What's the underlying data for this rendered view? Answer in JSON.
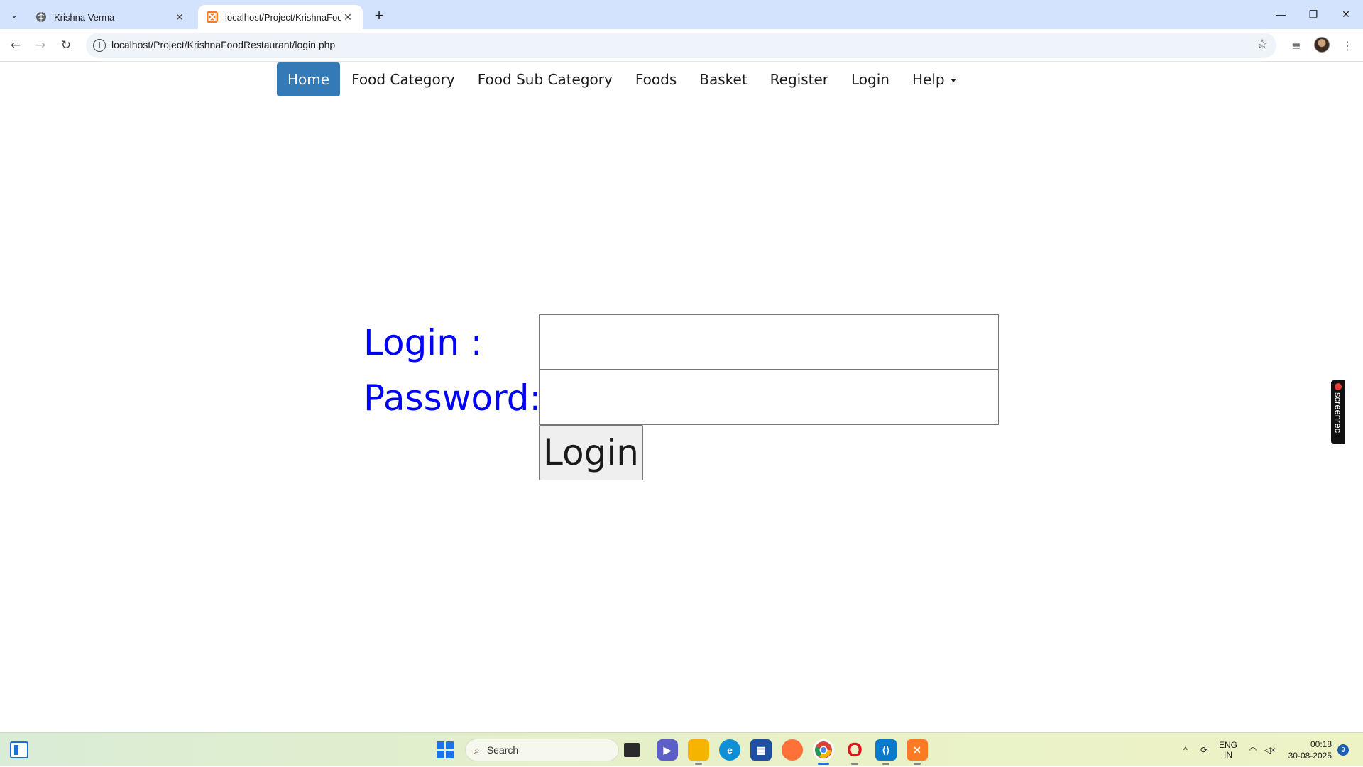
{
  "browser": {
    "tabs": [
      {
        "title": "Krishna Verma",
        "active": false
      },
      {
        "title": "localhost/Project/KrishnaFoodR",
        "active": true
      }
    ],
    "url": "localhost/Project/KrishnaFoodRestaurant/login.php",
    "icons": {
      "tab_search": "chevron-down-icon",
      "back": "back-arrow-icon",
      "forward": "forward-arrow-icon",
      "reload": "reload-icon",
      "site_info": "info-icon",
      "bookmark": "star-icon",
      "media": "media-control-icon",
      "profile": "avatar",
      "menu": "kebab-menu-icon"
    }
  },
  "nav": {
    "items": [
      {
        "label": "Home",
        "active": true
      },
      {
        "label": "Food Category",
        "active": false
      },
      {
        "label": "Food Sub Category",
        "active": false
      },
      {
        "label": "Foods",
        "active": false
      },
      {
        "label": "Basket",
        "active": false
      },
      {
        "label": "Register",
        "active": false
      },
      {
        "label": "Login",
        "active": false
      },
      {
        "label": "Help",
        "active": false,
        "dropdown": true
      }
    ],
    "active_color": "#337ab7"
  },
  "form": {
    "login_label": "Login :",
    "password_label": "Password:",
    "login_value": "",
    "password_value": "",
    "submit_label": "Login",
    "label_color": "#0000ff"
  },
  "screenrec": {
    "label": "screenrec"
  },
  "taskbar": {
    "search_placeholder": "Search",
    "apps": [
      "task-view",
      "teams",
      "file-explorer",
      "edge",
      "microsoft-store",
      "firefox",
      "chrome",
      "opera",
      "vscode",
      "xampp"
    ],
    "tray": {
      "lang_top": "ENG",
      "lang_bottom": "IN",
      "time": "00:18",
      "date": "30-08-2025",
      "notifications": "9"
    }
  }
}
